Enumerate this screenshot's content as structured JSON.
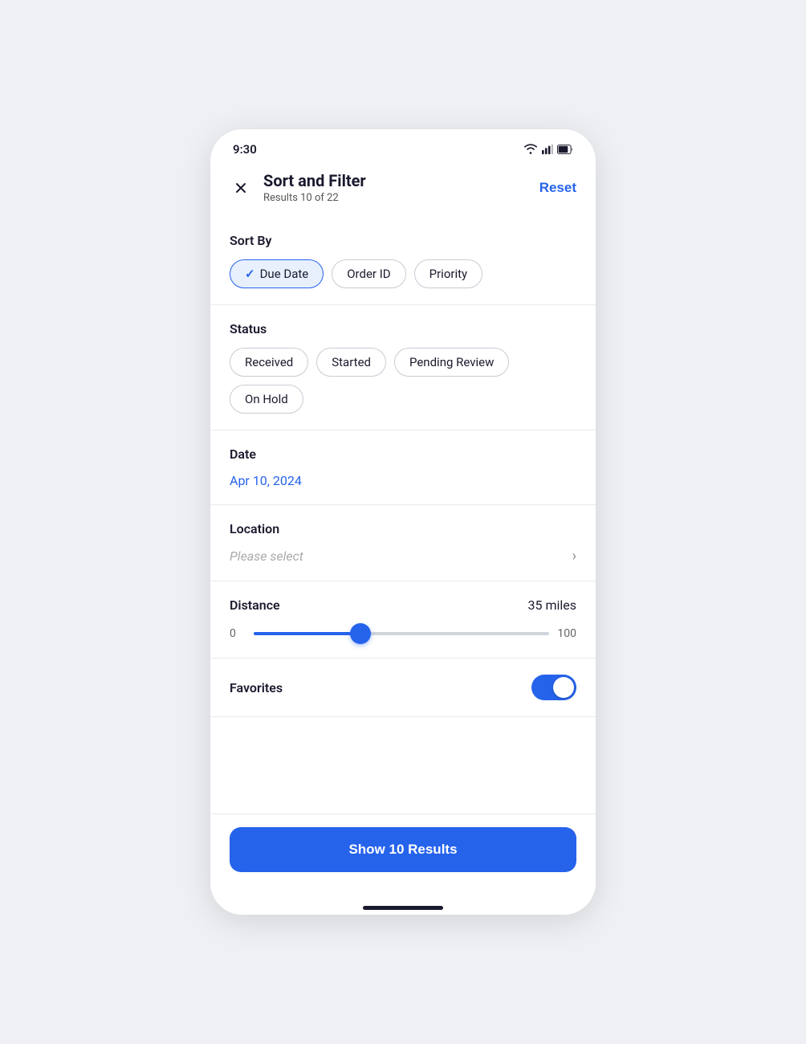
{
  "statusBar": {
    "time": "9:30"
  },
  "header": {
    "title": "Sort and Filter",
    "subtitle": "Results 10 of 22",
    "resetLabel": "Reset"
  },
  "sortBy": {
    "label": "Sort By",
    "options": [
      {
        "id": "due-date",
        "label": "Due Date",
        "active": true
      },
      {
        "id": "order-id",
        "label": "Order ID",
        "active": false
      },
      {
        "id": "priority",
        "label": "Priority",
        "active": false
      }
    ]
  },
  "status": {
    "label": "Status",
    "options": [
      {
        "id": "received",
        "label": "Received",
        "active": false
      },
      {
        "id": "started",
        "label": "Started",
        "active": false
      },
      {
        "id": "pending-review",
        "label": "Pending Review",
        "active": false
      },
      {
        "id": "on-hold",
        "label": "On Hold",
        "active": false
      }
    ]
  },
  "date": {
    "label": "Date",
    "value": "Apr 10, 2024"
  },
  "location": {
    "label": "Location",
    "placeholder": "Please select"
  },
  "distance": {
    "label": "Distance",
    "value": "35 miles",
    "min": "0",
    "max": "100",
    "current": 35
  },
  "favorites": {
    "label": "Favorites",
    "enabled": true
  },
  "footer": {
    "buttonLabel": "Show 10 Results"
  }
}
